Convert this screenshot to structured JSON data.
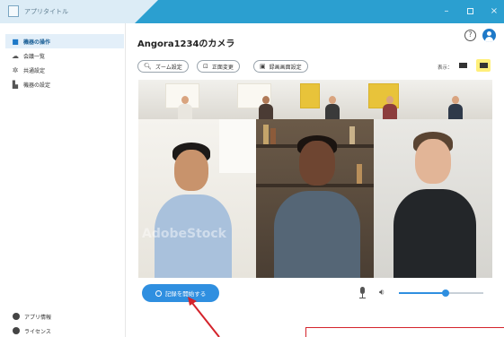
{
  "window": {
    "title": "アプリタイトル",
    "controls": {
      "minimize": "–",
      "maximize": "",
      "close": "×"
    }
  },
  "sidebar": {
    "items": [
      {
        "label": "機器の操作",
        "icon": "camera-icon",
        "active": true
      },
      {
        "label": "会議一覧",
        "icon": "cloud-icon",
        "active": false
      },
      {
        "label": "共通設定",
        "icon": "gear-icon",
        "active": false
      },
      {
        "label": "機器の設定",
        "icon": "device-settings-icon",
        "active": false
      }
    ],
    "footer": [
      {
        "label": "アプリ情報",
        "icon": "info-icon"
      },
      {
        "label": "ライセンス",
        "icon": "license-icon"
      }
    ]
  },
  "main": {
    "camera_title": "Angora1234のカメラ",
    "help_icon": "?",
    "toolbar": {
      "zoom_label": "ズーム設定",
      "front_label": "正面変更",
      "record_screen_label": "録画画面設定"
    },
    "display_label": "表示：",
    "video": {
      "watermark": "AdobeStock"
    },
    "record_button_label": "記録を開始する",
    "volume_level": 0.55
  },
  "colors": {
    "accent": "#2f8fe0",
    "titlebar": "#2b9fd0",
    "layout_selected": "#ffef7a",
    "annotation": "#d4232b"
  }
}
